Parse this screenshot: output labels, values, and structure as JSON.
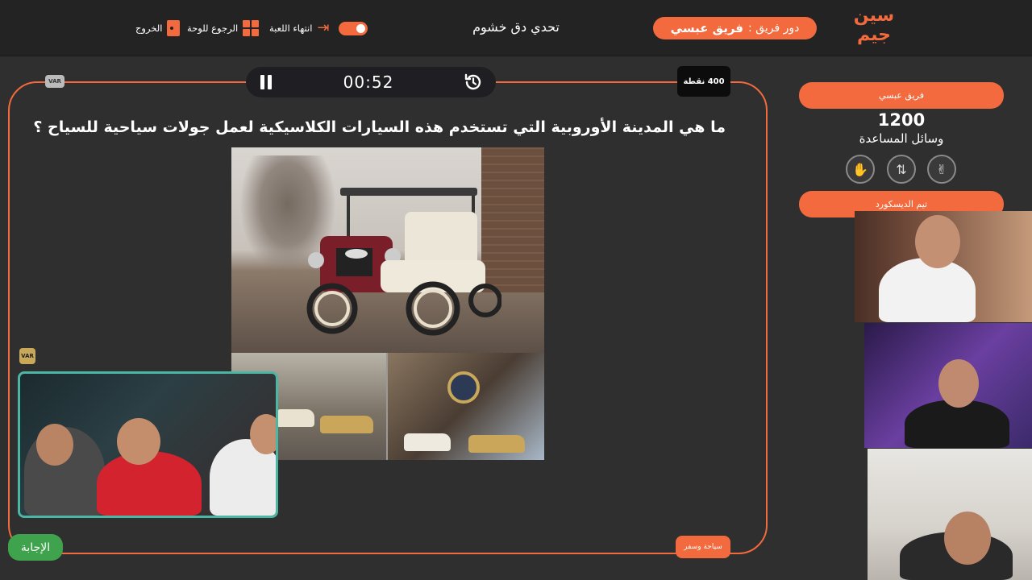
{
  "header": {
    "logo_line1": "سين",
    "logo_line2": "جيم",
    "turn_prefix": "دور فريق :",
    "turn_team": "فريق عبسي",
    "challenge_title": "تحدي دق خشوم",
    "nav": {
      "end_game": "انتهاء اللعبة",
      "back_to_board": "الرجوع للوحة",
      "exit": "الخروج"
    }
  },
  "question_panel": {
    "timer": "00:52",
    "points": "400 نقطة",
    "var_label": "VAR",
    "question_text": "ما هي المدينة الأوروبية التي تستخدم هذه السيارات الكلاسيكية لعمل جولات سياحية للسياح ؟",
    "category": "سياحة وسفر",
    "answer_button": "الإجابة"
  },
  "team1": {
    "name": "فريق عبسي",
    "score": "1200",
    "helpers_label": "وسائل المساعدة"
  },
  "team2": {
    "name": "تيم الديسكورد"
  },
  "colors": {
    "accent": "#f26a3d",
    "answer": "#3fa34d",
    "background": "#2f2f2f",
    "topbar": "#232323"
  },
  "icons": {
    "pause": "pause-icon",
    "restart": "restart-clock-icon",
    "helper1": "hand-icon",
    "helper2": "swap-icon",
    "helper3": "peace-icon"
  }
}
